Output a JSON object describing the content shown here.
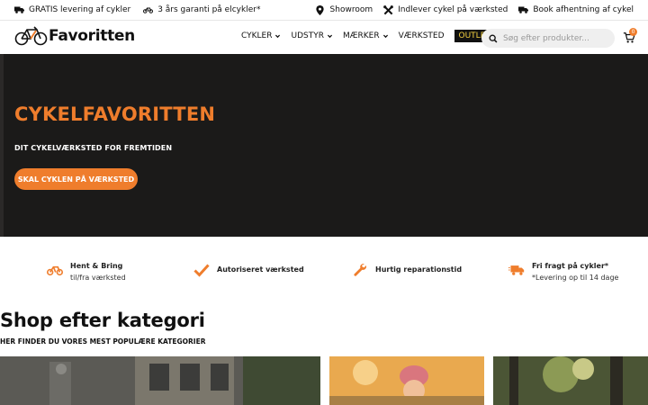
{
  "topbar": {
    "left": [
      {
        "icon": "truck-icon",
        "text": "GRATIS levering af cykler"
      },
      {
        "icon": "bicycle-icon",
        "text": "3 års garanti på elcykler*"
      }
    ],
    "right": [
      {
        "icon": "map-pin-icon",
        "text": "Showroom"
      },
      {
        "icon": "tools-icon",
        "text": "Indlever cykel på værksted"
      },
      {
        "icon": "truck-icon",
        "text": "Book afhentning af cykel"
      }
    ]
  },
  "header": {
    "logo_text": "Favoritten",
    "nav": [
      {
        "label": "CYKLER",
        "dropdown": true
      },
      {
        "label": "UDSTYR",
        "dropdown": true
      },
      {
        "label": "MÆRKER",
        "dropdown": true
      },
      {
        "label": "VÆRKSTED",
        "dropdown": false
      },
      {
        "label": "OUTLET",
        "dropdown": false
      }
    ],
    "search_placeholder": "Søg efter produkter...",
    "cart_count": "0"
  },
  "hero": {
    "title": "CYKELFAVORITTEN",
    "subtitle": "DIT CYKELVÆRKSTED FOR FREMTIDEN",
    "button": "SKAL CYKLEN PÅ VÆRKSTED"
  },
  "features": [
    {
      "icon": "bicycle-icon",
      "title": "Hent & Bring",
      "sub": "til/fra værksted"
    },
    {
      "icon": "checkmark-icon",
      "title": "Autoriseret værksted",
      "sub": ""
    },
    {
      "icon": "wrench-icon",
      "title": "Hurtig reparationstid",
      "sub": ""
    },
    {
      "icon": "fast-truck-icon",
      "title": "Fri fragt på cykler*",
      "sub": "*Levering op til 14 dage"
    }
  ],
  "categories": {
    "title": "Shop efter kategori",
    "subtitle": "HER FINDER DU VORES MEST POPULÆRE KATEGORIER"
  },
  "colors": {
    "accent": "#ef7d2c",
    "hero_bg": "#1b1a19",
    "outlet_text": "#f6d23f"
  }
}
